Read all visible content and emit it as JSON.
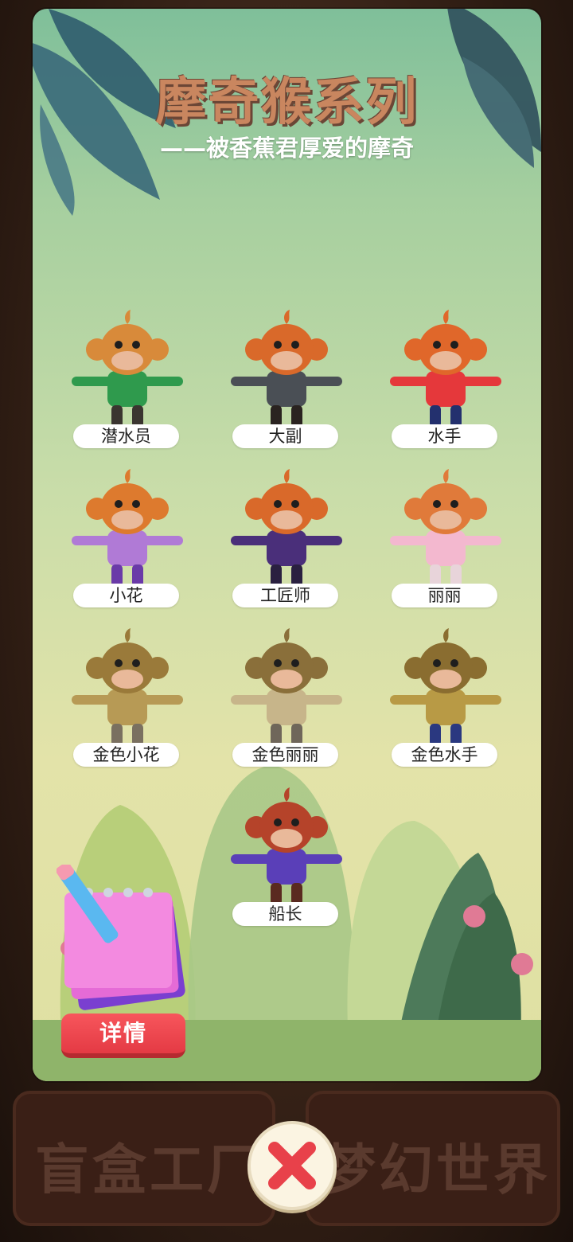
{
  "background": {
    "labels": [
      "盲盒工厂",
      "梦幻世界"
    ]
  },
  "modal": {
    "title": "摩奇猴系列",
    "subtitle": "——被香蕉君厚爱的摩奇",
    "figures": [
      {
        "name": "潜水员",
        "body": "#2f9a4d",
        "head": "#d88a3a",
        "legs": "#3a3530"
      },
      {
        "name": "大副",
        "body": "#4a4f55",
        "head": "#d9692a",
        "legs": "#2a2320"
      },
      {
        "name": "水手",
        "body": "#e5383b",
        "head": "#e0672a",
        "legs": "#23306e"
      },
      {
        "name": "小花",
        "body": "#b07ad6",
        "head": "#dd7a2e",
        "legs": "#6a3aa8"
      },
      {
        "name": "工匠师",
        "body": "#4a2f7a",
        "head": "#d9692a",
        "legs": "#2a2040"
      },
      {
        "name": "丽丽",
        "body": "#f3b8cf",
        "head": "#e07a3a",
        "legs": "#e8d4da"
      },
      {
        "name": "金色小花",
        "body": "#b79a55",
        "head": "#9a7a3a",
        "legs": "#7a7060"
      },
      {
        "name": "金色丽丽",
        "body": "#c7b58a",
        "head": "#8a6f3a",
        "legs": "#6f665a"
      },
      {
        "name": "金色水手",
        "body": "#b89a45",
        "head": "#8a6d30",
        "legs": "#2a3880"
      },
      {
        "name": "船长",
        "body": "#5a3fb8",
        "head": "#b5432a",
        "legs": "#5a2a20"
      }
    ],
    "detail_label": "详情"
  },
  "colors": {
    "accent_red": "#e8414a",
    "title_brown": "#c9865f"
  }
}
